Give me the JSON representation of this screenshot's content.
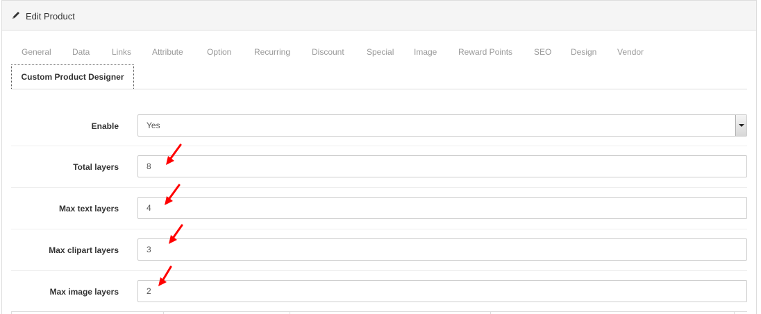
{
  "header": {
    "title": "Edit Product"
  },
  "tabs": [
    {
      "label": "General"
    },
    {
      "label": "Data"
    },
    {
      "label": "Links"
    },
    {
      "label": "Attribute"
    },
    {
      "label": "Option"
    },
    {
      "label": "Recurring"
    },
    {
      "label": "Discount"
    },
    {
      "label": "Special"
    },
    {
      "label": "Image"
    },
    {
      "label": "Reward Points"
    },
    {
      "label": "SEO"
    },
    {
      "label": "Design"
    },
    {
      "label": "Vendor"
    }
  ],
  "active_tab": {
    "label": "Custom Product Designer"
  },
  "form": {
    "enable": {
      "label": "Enable",
      "value": "Yes"
    },
    "total_layers": {
      "label": "Total layers",
      "value": "8"
    },
    "max_text_layers": {
      "label": "Max text layers",
      "value": "4"
    },
    "max_clipart_layers": {
      "label": "Max clipart layers",
      "value": "3"
    },
    "max_image_layers": {
      "label": "Max image layers",
      "value": "2"
    }
  },
  "colors": {
    "annotation_arrow": "#ff0000",
    "tab_inactive": "#999999",
    "heading_bg": "#f5f5f5"
  },
  "icons": {
    "heading": "pencil-icon",
    "annotation": "red-arrow-icon"
  }
}
